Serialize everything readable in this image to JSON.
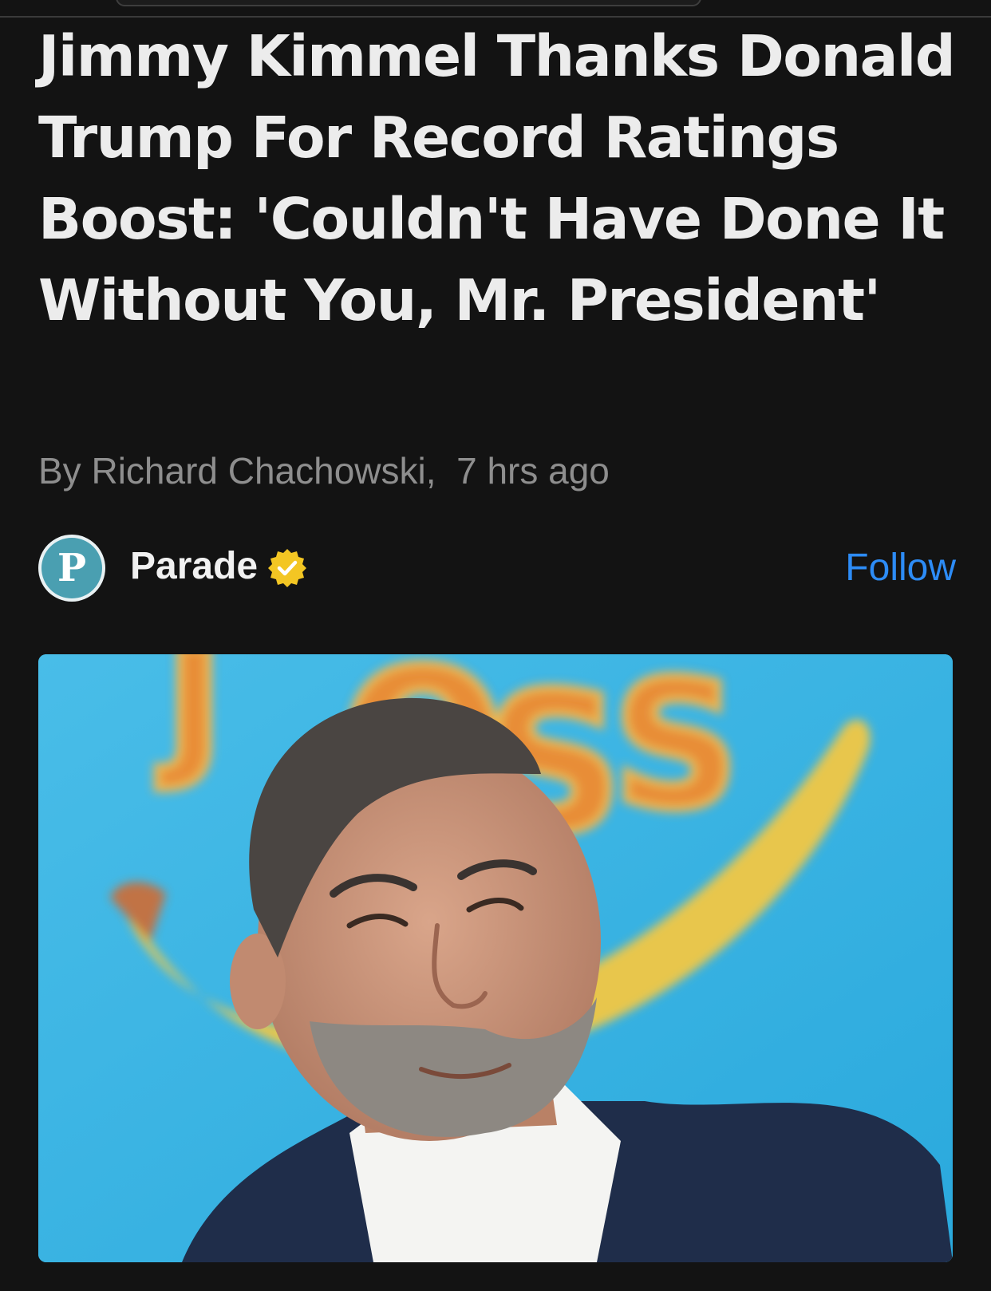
{
  "article": {
    "headline": "Jimmy Kimmel Thanks Donald Trump For Record Ratings Boost: 'Couldn't Have Done It Without You, Mr. President'",
    "author_prefix": "By",
    "author": "Richard Chachowski,",
    "time_ago": "7 hrs ago"
  },
  "publisher": {
    "logo_letter": "P",
    "name": "Parade",
    "verified_icon": "verified-badge-icon",
    "follow_label": "Follow"
  },
  "hero_image": {
    "description_icon": "article-hero-photo"
  },
  "colors": {
    "background": "#131313",
    "headline": "#ececec",
    "byline": "#8e8e8e",
    "follow": "#2d8cf6",
    "badge": "#f3c623",
    "logo": "#4a9fb1"
  }
}
